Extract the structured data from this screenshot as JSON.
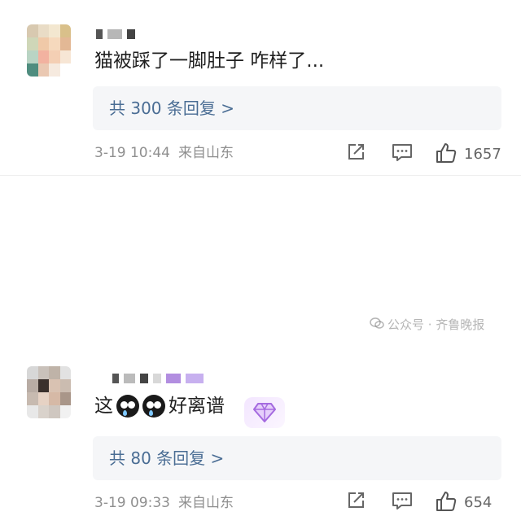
{
  "comments": [
    {
      "text": "猫被踩了一脚肚子 咋样了...",
      "reply_link": "共 300 条回复 >",
      "time": "3-19 10:44",
      "source": "来自山东",
      "likes": "1657",
      "icons": {
        "share": "share-icon",
        "reply": "comment-icon",
        "like": "thumbs-up-icon"
      }
    },
    {
      "text_before": "这",
      "text_after": "好离谱",
      "reply_link": "共 80 条回复 >",
      "time": "3-19 09:33",
      "source": "来自山东",
      "likes": "654",
      "icons": {
        "share": "share-icon",
        "reply": "comment-icon",
        "like": "thumbs-up-icon"
      }
    }
  ],
  "watermark": "公众号 · 齐鲁晚报",
  "colors": {
    "link": "#4a6d94",
    "meta": "#8f8f8f",
    "reply_bg": "#f5f6f8",
    "badge": "#b070e8"
  }
}
